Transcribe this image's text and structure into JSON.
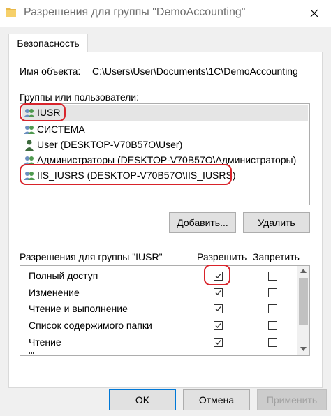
{
  "window": {
    "title": "Разрешения для группы \"DemoAccounting\""
  },
  "tabs": [
    {
      "label": "Безопасность"
    }
  ],
  "object": {
    "label": "Имя объекта:",
    "value": "C:\\Users\\User\\Documents\\1C\\DemoAccounting"
  },
  "groups": {
    "label": "Группы или пользователи:",
    "items": [
      {
        "name": "IUSR",
        "icon": "users-group-icon"
      },
      {
        "name": "СИСТЕМА",
        "icon": "users-group-icon"
      },
      {
        "name": "User (DESKTOP-V70B57O\\User)",
        "icon": "user-icon"
      },
      {
        "name": "Администраторы (DESKTOP-V70B57O\\Администраторы)",
        "icon": "users-group-icon"
      },
      {
        "name": "IIS_IUSRS (DESKTOP-V70B57O\\IIS_IUSRS)",
        "icon": "users-group-icon"
      }
    ]
  },
  "buttons": {
    "add": "Добавить...",
    "remove": "Удалить",
    "ok": "OK",
    "cancel": "Отмена",
    "apply": "Применить"
  },
  "permissions": {
    "label": "Разрешения для группы \"IUSR\"",
    "allow_header": "Разрешить",
    "deny_header": "Запретить",
    "items": [
      {
        "name": "Полный доступ",
        "allow": true,
        "deny": false
      },
      {
        "name": "Изменение",
        "allow": true,
        "deny": false
      },
      {
        "name": "Чтение и выполнение",
        "allow": true,
        "deny": false
      },
      {
        "name": "Список содержимого папки",
        "allow": true,
        "deny": false
      },
      {
        "name": "Чтение",
        "allow": true,
        "deny": false
      }
    ]
  },
  "colors": {
    "highlight": "#d8232a",
    "accent": "#0078d7"
  }
}
